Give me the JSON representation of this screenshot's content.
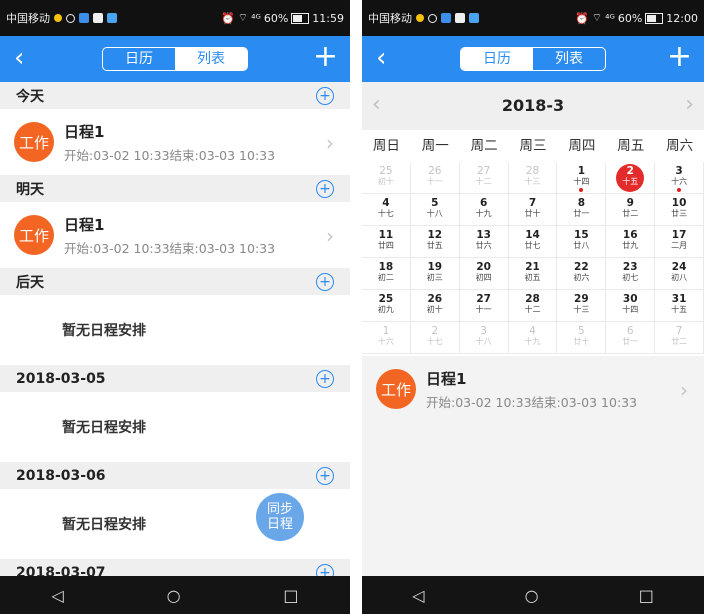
{
  "status_left": {
    "carrier": "中国移动",
    "wifi": "⌔",
    "signal": "⁴ᴳ",
    "battery": "60%",
    "time": "11:59"
  },
  "status_right": {
    "carrier": "中国移动",
    "wifi": "⌔",
    "signal": "⁴ᴳ",
    "battery": "60%",
    "time": "12:00"
  },
  "header": {
    "back": "‹",
    "add": "+",
    "tab_calendar": "日历",
    "tab_list": "列表"
  },
  "list_view": {
    "sections": [
      {
        "title": "今天",
        "event": {
          "badge": "工作",
          "title": "日程1",
          "time": "开始:03-02 10:33结束:03-03 10:33"
        }
      },
      {
        "title": "明天",
        "event": {
          "badge": "工作",
          "title": "日程1",
          "time": "开始:03-02 10:33结束:03-03 10:33"
        }
      },
      {
        "title": "后天",
        "empty": "暂无日程安排"
      },
      {
        "title": "2018-03-05",
        "empty": "暂无日程安排"
      },
      {
        "title": "2018-03-06",
        "empty": "暂无日程安排"
      },
      {
        "title": "2018-03-07"
      }
    ],
    "sync_button": [
      "同步",
      "日程"
    ]
  },
  "calendar_view": {
    "month": "2018-3",
    "weekdays": [
      "周日",
      "周一",
      "周二",
      "周三",
      "周四",
      "周五",
      "周六"
    ],
    "weeks": [
      [
        {
          "d": "25",
          "l": "初十",
          "muted": true
        },
        {
          "d": "26",
          "l": "十一",
          "muted": true
        },
        {
          "d": "27",
          "l": "十二",
          "muted": true
        },
        {
          "d": "28",
          "l": "十三",
          "muted": true
        },
        {
          "d": "1",
          "l": "十四",
          "mark": true
        },
        {
          "d": "2",
          "l": "十五",
          "today": true,
          "mark": true
        },
        {
          "d": "3",
          "l": "十六",
          "mark": true
        }
      ],
      [
        {
          "d": "4",
          "l": "十七"
        },
        {
          "d": "5",
          "l": "十八"
        },
        {
          "d": "6",
          "l": "十九"
        },
        {
          "d": "7",
          "l": "廿十"
        },
        {
          "d": "8",
          "l": "廿一"
        },
        {
          "d": "9",
          "l": "廿二"
        },
        {
          "d": "10",
          "l": "廿三"
        }
      ],
      [
        {
          "d": "11",
          "l": "廿四"
        },
        {
          "d": "12",
          "l": "廿五"
        },
        {
          "d": "13",
          "l": "廿六"
        },
        {
          "d": "14",
          "l": "廿七"
        },
        {
          "d": "15",
          "l": "廿八"
        },
        {
          "d": "16",
          "l": "廿九"
        },
        {
          "d": "17",
          "l": "二月"
        }
      ],
      [
        {
          "d": "18",
          "l": "初二"
        },
        {
          "d": "19",
          "l": "初三"
        },
        {
          "d": "20",
          "l": "初四"
        },
        {
          "d": "21",
          "l": "初五"
        },
        {
          "d": "22",
          "l": "初六"
        },
        {
          "d": "23",
          "l": "初七"
        },
        {
          "d": "24",
          "l": "初八"
        }
      ],
      [
        {
          "d": "25",
          "l": "初九"
        },
        {
          "d": "26",
          "l": "初十"
        },
        {
          "d": "27",
          "l": "十一"
        },
        {
          "d": "28",
          "l": "十二"
        },
        {
          "d": "29",
          "l": "十三"
        },
        {
          "d": "30",
          "l": "十四"
        },
        {
          "d": "31",
          "l": "十五"
        }
      ],
      [
        {
          "d": "1",
          "l": "十六",
          "muted": true
        },
        {
          "d": "2",
          "l": "十七",
          "muted": true
        },
        {
          "d": "3",
          "l": "十八",
          "muted": true
        },
        {
          "d": "4",
          "l": "十九",
          "muted": true
        },
        {
          "d": "5",
          "l": "廿十",
          "muted": true
        },
        {
          "d": "6",
          "l": "廿一",
          "muted": true
        },
        {
          "d": "7",
          "l": "廿二",
          "muted": true
        }
      ]
    ],
    "event": {
      "badge": "工作",
      "title": "日程1",
      "time": "开始:03-02 10:33结束:03-03 10:33"
    }
  },
  "nav": {
    "back": "◁",
    "home": "○",
    "recent": "□"
  },
  "icons": {
    "chevron": "›",
    "plus_circle": "+",
    "prev": "‹",
    "next": "›"
  },
  "colors": {
    "header_blue": "#2a8cf0",
    "work_badge": "#f26522",
    "today_red": "#e42b2b"
  }
}
